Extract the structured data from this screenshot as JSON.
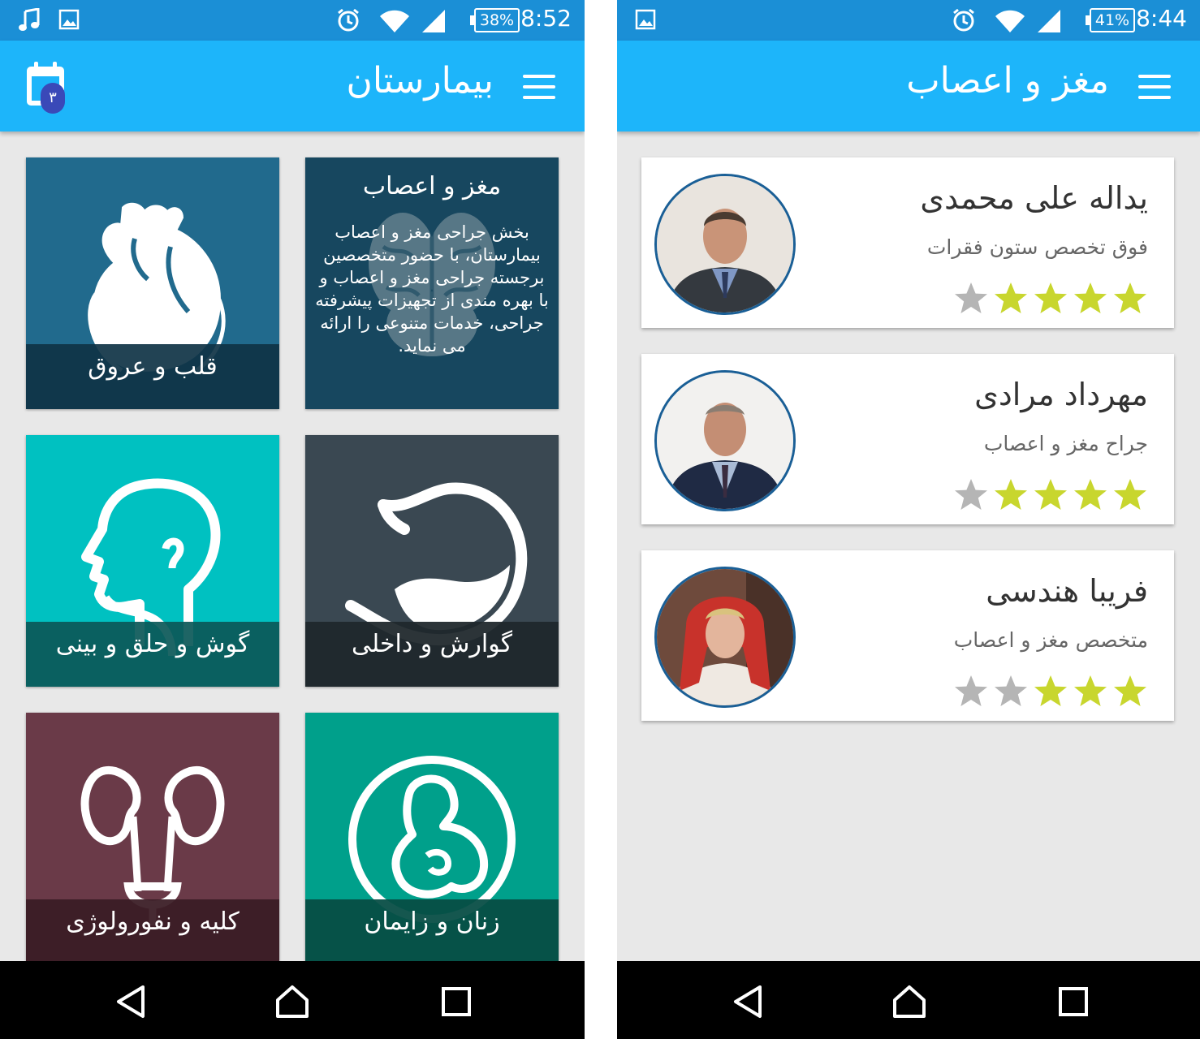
{
  "colors": {
    "status_bar": "#1b8fd6",
    "app_bar": "#1db5fa",
    "background": "#e8e8e8",
    "nav_bar": "#000000",
    "star_filled": "#c8d62e",
    "star_empty": "#b5b5b5",
    "avatar_border": "#1a5f96"
  },
  "left": {
    "status": {
      "time": "8:52",
      "battery": "38%",
      "icons": [
        "music-note-icon",
        "image-icon",
        "alarm-icon",
        "wifi-icon",
        "signal-icon",
        "battery-icon"
      ]
    },
    "app_bar": {
      "title": "بیمارستان",
      "calendar_badge": "۳"
    },
    "tiles": [
      {
        "id": "heart",
        "label": "قلب و عروق",
        "icon": "heart-icon",
        "color": "#216a8d",
        "band": "#0f3345"
      },
      {
        "id": "brain",
        "heading": "مغز و اعصاب",
        "description": "بخش جراحی مغز و اعصاب بیمارستان، با حضور متخصصین برجسته جراحی مغز و اعصاب و با بهره مندی از تجهیزات پیشرفته جراحی، خدمات متنوعی را ارائه می نماید.",
        "icon": "brain-icon",
        "color": "#17475f"
      },
      {
        "id": "ent",
        "label": "گوش و حلق و بینی",
        "icon": "head-throat-icon",
        "color": "#00c1c1",
        "band": "#0b5858"
      },
      {
        "id": "digestive",
        "label": "گوارش و داخلی",
        "icon": "stomach-icon",
        "color": "#3a4852",
        "band": "#1f272c"
      },
      {
        "id": "kidney",
        "label": "کلیه و نفورولوژی",
        "icon": "kidney-icon",
        "color": "#6a3a48",
        "band": "#3a1d25"
      },
      {
        "id": "women",
        "label": "زنان و زایمان",
        "icon": "fetus-icon",
        "color": "#00a08b",
        "band": "#064d44"
      }
    ]
  },
  "right": {
    "status": {
      "time": "8:44",
      "battery": "41%",
      "icons": [
        "image-icon",
        "alarm-icon",
        "wifi-icon",
        "signal-icon",
        "battery-icon"
      ]
    },
    "app_bar": {
      "title": "مغز و اعصاب"
    },
    "doctors": [
      {
        "name": "یداله علی محمدی",
        "specialty": "فوق تخصص ستون فقرات",
        "rating": 4,
        "max_rating": 5
      },
      {
        "name": "مهرداد مرادی",
        "specialty": "جراح مغز و اعصاب",
        "rating": 4,
        "max_rating": 5
      },
      {
        "name": "فریبا هندسی",
        "specialty": "متخصص مغز و اعصاب",
        "rating": 3,
        "max_rating": 5
      }
    ]
  },
  "nav": {
    "icons": [
      "back-icon",
      "home-icon",
      "recents-icon"
    ]
  }
}
